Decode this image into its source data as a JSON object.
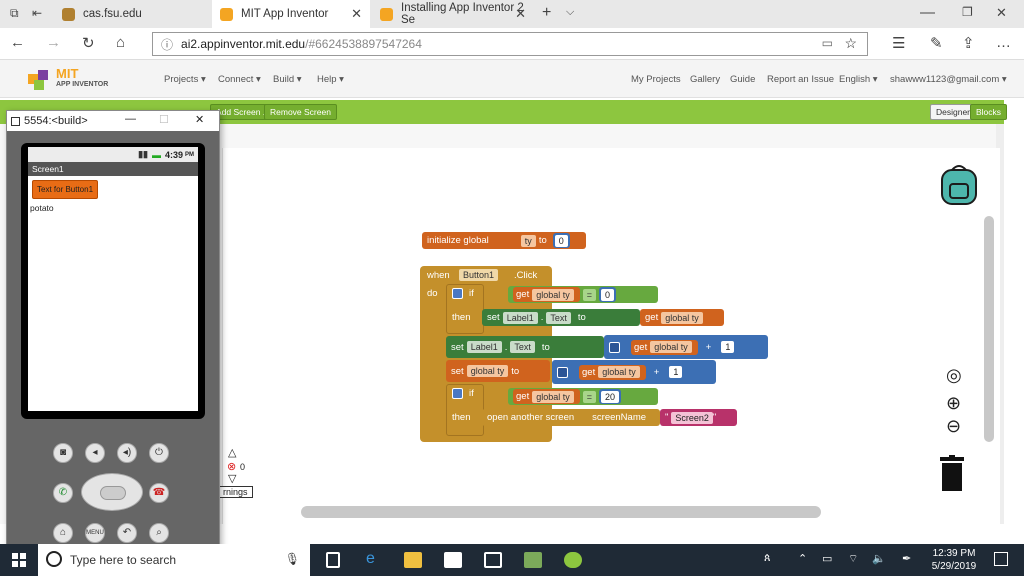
{
  "browser": {
    "tabs": [
      {
        "title": "cas.fsu.edu"
      },
      {
        "title": "MIT App Inventor"
      },
      {
        "title": "Installing App Inventor 2 Se"
      }
    ],
    "url_host": "ai2.appinventor.mit.edu",
    "url_rest": "/#6624538897547264"
  },
  "ai": {
    "logo_text": "MIT",
    "logo_sub": "APP INVENTOR",
    "menus": [
      "Projects ▾",
      "Connect ▾",
      "Build ▾",
      "Help ▾"
    ],
    "right_menus": [
      "My Projects",
      "Gallery",
      "Guide",
      "Report an Issue",
      "English ▾",
      "shawww1123@gmail.com ▾"
    ],
    "green_buttons": {
      "add_screen": "Add Screen ...",
      "remove_screen": "Remove Screen",
      "designer": "Designer",
      "blocks": "Blocks"
    }
  },
  "emulator": {
    "title": "5554:<build>",
    "time": "4:39",
    "ampm": "PM",
    "screen_title": "Screen1",
    "button_text": "Text for Button1",
    "label_text": "potato",
    "menu_label": "MENU"
  },
  "blocks": {
    "init": {
      "label": "initialize global",
      "var": "ty",
      "to": "to",
      "value": "0"
    },
    "event": {
      "when": "when",
      "component": "Button1",
      "event": ".Click",
      "do": "do"
    },
    "if1": {
      "if": "if",
      "get": "get",
      "var": "global ty",
      "op": "=",
      "value": "0",
      "then": "then"
    },
    "set1": {
      "set": "set",
      "comp": "Label1",
      "prop": "Text",
      "to": "to",
      "get": "get",
      "var": "global ty"
    },
    "set2": {
      "set": "set",
      "comp": "Label1",
      "prop": "Text",
      "to": "to",
      "get": "get",
      "var": "global ty",
      "op": "+",
      "value": "1"
    },
    "set3": {
      "set": "set",
      "var": "global ty",
      "to": "to",
      "get": "get",
      "gvar": "global ty",
      "op": "+",
      "value": "1"
    },
    "if2": {
      "if": "if",
      "get": "get",
      "var": "global ty",
      "op": "=",
      "value": "20",
      "then": "then",
      "action": "open another screen",
      "param": "screenName",
      "screen": "Screen2"
    }
  },
  "warnings": {
    "count": "0",
    "label": "rnings"
  },
  "taskbar": {
    "search_placeholder": "Type here to search",
    "time": "12:39 PM",
    "date": "5/29/2019"
  }
}
